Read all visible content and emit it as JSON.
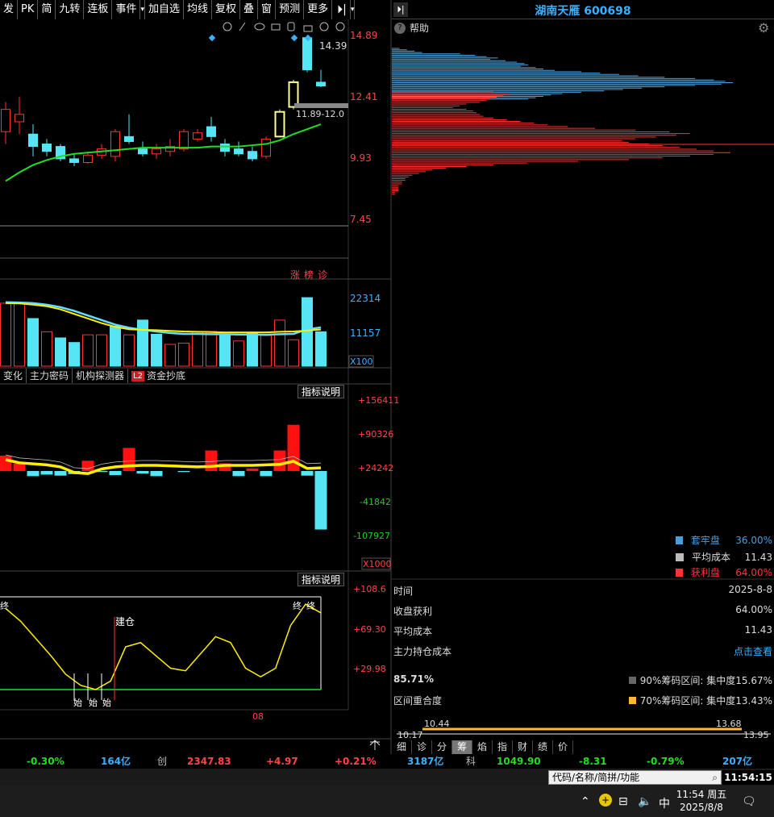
{
  "toolbar": {
    "items": [
      "发",
      "PK",
      "简",
      "九转",
      "连板",
      "事件",
      "▾",
      "加自选",
      "均线",
      "复权",
      "叠",
      "窗",
      "预测",
      "更多",
      "⏵|",
      "▾"
    ]
  },
  "stock": {
    "title": "湖南天雁 600698"
  },
  "kline": {
    "price_ticks": [
      "14.89",
      "12.41",
      "9.93",
      "7.45"
    ],
    "high_label": "14.39",
    "range_label": "11.89-12.0",
    "candles": [
      {
        "o": 11.0,
        "c": 11.9,
        "h": 12.2,
        "l": 10.5
      },
      {
        "o": 11.4,
        "c": 11.7,
        "h": 12.4,
        "l": 10.9
      },
      {
        "o": 10.9,
        "c": 10.4,
        "h": 11.3,
        "l": 10.0
      },
      {
        "o": 10.5,
        "c": 10.2,
        "h": 10.7,
        "l": 10.0
      },
      {
        "o": 10.4,
        "c": 9.9,
        "h": 10.5,
        "l": 9.8
      },
      {
        "o": 9.9,
        "c": 9.75,
        "h": 10.1,
        "l": 9.6
      },
      {
        "o": 9.75,
        "c": 10.05,
        "h": 10.2,
        "l": 9.7
      },
      {
        "o": 10.05,
        "c": 10.3,
        "h": 10.5,
        "l": 9.9
      },
      {
        "o": 10.0,
        "c": 11.0,
        "h": 11.1,
        "l": 9.8
      },
      {
        "o": 10.8,
        "c": 10.6,
        "h": 11.7,
        "l": 10.5
      },
      {
        "o": 10.3,
        "c": 10.1,
        "h": 10.6,
        "l": 10.0
      },
      {
        "o": 10.1,
        "c": 10.3,
        "h": 10.5,
        "l": 9.9
      },
      {
        "o": 10.2,
        "c": 10.4,
        "h": 10.7,
        "l": 10.0
      },
      {
        "o": 10.3,
        "c": 11.0,
        "h": 11.1,
        "l": 10.2
      },
      {
        "o": 10.7,
        "c": 10.95,
        "h": 11.1,
        "l": 10.6
      },
      {
        "o": 11.2,
        "c": 10.8,
        "h": 11.6,
        "l": 10.6
      },
      {
        "o": 10.5,
        "c": 10.2,
        "h": 10.7,
        "l": 10.0
      },
      {
        "o": 10.3,
        "c": 10.1,
        "h": 10.6,
        "l": 10.0
      },
      {
        "o": 10.2,
        "c": 9.9,
        "h": 10.4,
        "l": 9.8
      },
      {
        "o": 10.0,
        "c": 10.7,
        "h": 10.8,
        "l": 9.9
      },
      {
        "o": 10.8,
        "c": 11.8,
        "h": 11.9,
        "l": 10.8
      },
      {
        "o": 12.0,
        "c": 13.0,
        "h": 13.1,
        "l": 11.9
      },
      {
        "o": 14.8,
        "c": 13.5,
        "h": 14.9,
        "l": 13.4
      },
      {
        "o": 13.0,
        "c": 12.85,
        "h": 13.5,
        "l": 12.8
      }
    ],
    "ma": [
      9.0,
      9.35,
      9.65,
      9.85,
      10.0,
      10.1,
      10.15,
      10.2,
      10.25,
      10.3,
      10.35,
      10.35,
      10.35,
      10.35,
      10.35,
      10.4,
      10.4,
      10.4,
      10.45,
      10.5,
      10.65,
      10.9,
      11.1,
      11.3
    ]
  },
  "rank_labels": [
    "涨",
    "榜",
    "诊"
  ],
  "volume": {
    "ticks": [
      "22314",
      "11157",
      "X100"
    ],
    "bars": [
      20500,
      20500,
      15500,
      11200,
      9200,
      7700,
      10200,
      10200,
      13000,
      10200,
      15000,
      10400,
      7100,
      7500,
      11200,
      11300,
      10200,
      8200,
      10800,
      10000,
      15000,
      8600,
      22300,
      11200
    ],
    "up": [
      1,
      1,
      0,
      1,
      0,
      0,
      1,
      1,
      0,
      1,
      0,
      0,
      1,
      1,
      1,
      1,
      0,
      1,
      0,
      1,
      1,
      1,
      0,
      0
    ],
    "ma1": [
      20500,
      20400,
      20000,
      19500,
      18500,
      17000,
      15500,
      14000,
      12800,
      12000,
      11800,
      11700,
      11500,
      11300,
      11200,
      11100,
      11000,
      11000,
      11000,
      11000,
      11200,
      11300,
      11600,
      11900
    ],
    "ma2": [
      20800,
      20700,
      20500,
      20000,
      19200,
      18000,
      16500,
      15000,
      13500,
      12500,
      11800,
      11300,
      10800,
      10500,
      10500,
      10400,
      10400,
      10300,
      10300,
      10200,
      10400,
      10500,
      12000,
      12600
    ]
  },
  "subtabs": [
    "变化",
    "主力密码",
    "机构探测器",
    "资金抄底"
  ],
  "subtab_badge": "L2",
  "flow": {
    "btn": "指标说明",
    "ticks": [
      "+156411",
      "+90326",
      "+24242",
      "-41842",
      "-107927",
      "X1000"
    ],
    "bars": [
      30000,
      15000,
      -10000,
      -7000,
      -9000,
      -6000,
      20000,
      -2000,
      -8000,
      45000,
      -5000,
      -10000,
      0,
      -2000,
      0,
      40000,
      15000,
      -10000,
      5000,
      -10000,
      40000,
      90000,
      -9000,
      -114000
    ],
    "line": [
      22000,
      16000,
      14000,
      12000,
      8000,
      -3000,
      -5000,
      4000,
      8000,
      10000,
      11000,
      11000,
      10000,
      9000,
      8000,
      9000,
      11000,
      11000,
      11000,
      12000,
      13000,
      19000,
      5000,
      6000
    ]
  },
  "osc": {
    "btn": "指标说明",
    "ticks": [
      "+108.6",
      "+69.30",
      "+29.98"
    ],
    "values": [
      95,
      80,
      60,
      40,
      18,
      5,
      0,
      10,
      50,
      55,
      40,
      25,
      22,
      42,
      62,
      55,
      25,
      15,
      25,
      75,
      100,
      90
    ],
    "build_label": "建仓",
    "bottom_labels": [
      "始",
      "始",
      "始"
    ],
    "top_labels": [
      "终",
      "终",
      "终"
    ],
    "date_label": "08"
  },
  "chips": {
    "blue": [
      0.02,
      0.04,
      0.06,
      0.08,
      0.18,
      0.22,
      0.25,
      0.28,
      0.26,
      0.3,
      0.33,
      0.35,
      0.36,
      0.34,
      0.38,
      0.4,
      0.43,
      0.5,
      0.55,
      0.6,
      0.65,
      0.72,
      0.8,
      0.85,
      0.88,
      0.9,
      0.87,
      0.8,
      0.72,
      0.66,
      0.61,
      0.56,
      0.5,
      0.45,
      0.42,
      0.4,
      0.38,
      0.36
    ],
    "red": [
      0.3,
      0.35,
      0.33,
      0.31,
      0.29,
      0.28,
      0.26,
      0.22,
      0.2,
      0.18,
      0.22,
      0.24,
      0.25,
      0.26,
      0.27,
      0.3,
      0.34,
      0.38,
      0.42,
      0.46,
      0.52,
      0.6,
      0.72,
      0.82,
      0.88,
      0.84,
      0.78,
      0.72,
      0.68,
      0.7,
      0.76,
      0.8,
      0.85,
      0.9,
      0.95,
      1.0,
      0.95,
      0.88,
      0.8,
      0.7,
      0.55,
      0.4,
      0.3,
      0.22,
      0.16,
      0.12,
      0.1,
      0.08,
      0.06,
      0.05,
      0.04,
      0.04,
      0.03,
      0.03,
      0.02,
      0.02,
      0.02,
      0.02,
      0.01,
      0.01
    ]
  },
  "legend": {
    "items": [
      {
        "label": "套牢盘",
        "value": "36.00%",
        "color": "#4a9fd8"
      },
      {
        "label": "平均成本",
        "value": "11.43",
        "color": "#bbbbbb"
      },
      {
        "label": "获利盘",
        "value": "64.00%",
        "color": "#ff3333"
      }
    ]
  },
  "info": {
    "rows": [
      {
        "label": "时间",
        "value": "2025-8-8"
      },
      {
        "label": "收盘获利",
        "value": "64.00%"
      },
      {
        "label": "平均成本",
        "value": "11.43"
      },
      {
        "label": "主力持仓成本",
        "value": "点击查看"
      }
    ],
    "pct": "85.71%",
    "overlap_label": "区间重合度",
    "conc90": "90%筹码区间: 集中度15.67%",
    "conc70": "70%筹码区间: 集中度13.43%",
    "range_vals": {
      "l1": "10.44",
      "r1": "13.68",
      "l2": "10.17",
      "r2": "13.95"
    }
  },
  "right_tabs": [
    "细",
    "诊",
    "分",
    "筹",
    "焰",
    "指",
    "财",
    "绩",
    "价"
  ],
  "status": {
    "items": [
      "-0.30%",
      "164亿",
      "创",
      "2347.83",
      "+4.97",
      "+0.21%",
      "3187亿",
      "科",
      "1049.90",
      "-8.31",
      "-0.79%",
      "207亿"
    ]
  },
  "search": {
    "placeholder": "代码/名称/简拼/功能"
  },
  "top_clock": "11:54:15",
  "taskbar": {
    "ime": "中",
    "time": "11:54 周五",
    "date": "2025/8/8"
  }
}
